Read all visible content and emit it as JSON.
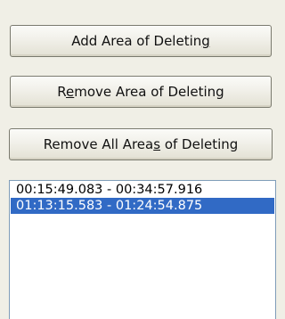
{
  "buttons": {
    "add_area": {
      "label_before": "Add Area of Deletin",
      "mnemonic": "g",
      "label_after": ""
    },
    "remove_area": {
      "label_before": "R",
      "mnemonic": "e",
      "label_after": "move Area of Deleting"
    },
    "remove_all_areas": {
      "label_before": "Remove All Area",
      "mnemonic": "s",
      "label_after": " of Deleting"
    }
  },
  "areas_list": {
    "items": [
      {
        "label": "00:15:49.083 - 00:34:57.916",
        "selected": false
      },
      {
        "label": "01:13:15.583 - 01:24:54.875",
        "selected": true
      }
    ]
  },
  "colors": {
    "window_bg": "#f0efe6",
    "selection_bg": "#316ac5",
    "selection_text": "#ffffff",
    "listbox_border": "#7f9db9"
  }
}
